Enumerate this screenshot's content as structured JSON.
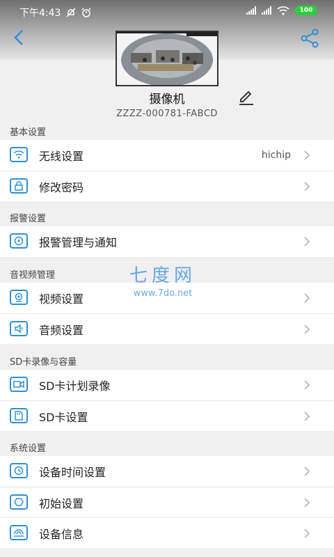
{
  "status": {
    "time": "下午4:43",
    "battery": "100"
  },
  "device": {
    "name": "摄像机",
    "id": "ZZZZ-000781-FABCD"
  },
  "sections": [
    {
      "title": "基本设置",
      "items": [
        {
          "label": "无线设置",
          "value": "hichip",
          "icon": "wifi-icon"
        },
        {
          "label": "修改密码",
          "value": "",
          "icon": "lock-icon"
        }
      ]
    },
    {
      "title": "报警设置",
      "items": [
        {
          "label": "报警管理与通知",
          "value": "",
          "icon": "alarm-icon"
        }
      ]
    },
    {
      "title": "音视频管理",
      "items": [
        {
          "label": "视频设置",
          "value": "",
          "icon": "video-icon"
        },
        {
          "label": "音频设置",
          "value": "",
          "icon": "speaker-icon"
        }
      ]
    },
    {
      "title": "SD卡录像与容量",
      "items": [
        {
          "label": "SD卡计划录像",
          "value": "",
          "icon": "record-icon"
        },
        {
          "label": "SD卡设置",
          "value": "",
          "icon": "sdcard-icon"
        }
      ]
    },
    {
      "title": "系统设置",
      "items": [
        {
          "label": "设备时间设置",
          "value": "",
          "icon": "clock-icon"
        },
        {
          "label": "初始设置",
          "value": "",
          "icon": "reset-icon"
        },
        {
          "label": "设备信息",
          "value": "",
          "icon": "info-icon"
        }
      ]
    }
  ],
  "watermark": {
    "title": "七度网",
    "url": "www.7do.net"
  },
  "colors": {
    "accent": "#2d8fd6"
  }
}
